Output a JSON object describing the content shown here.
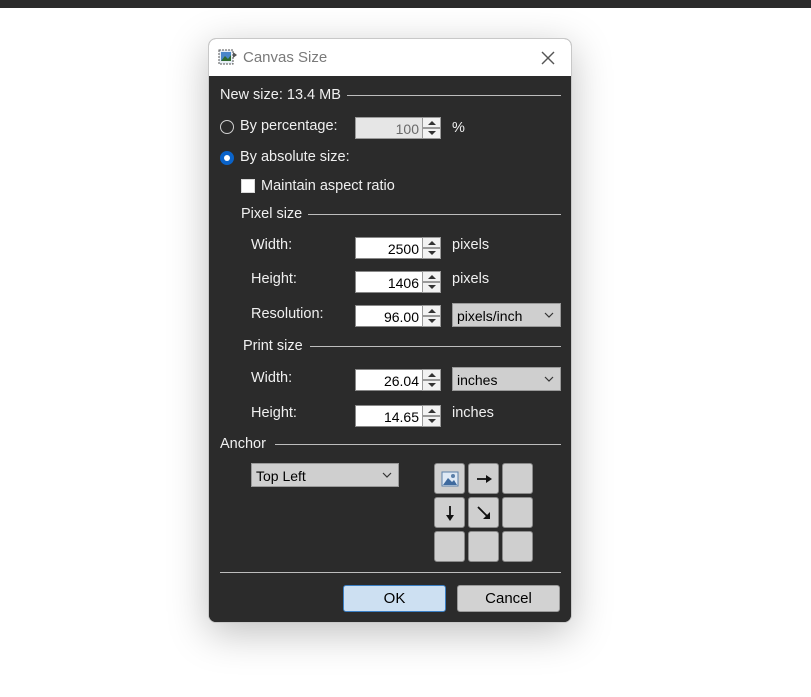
{
  "window": {
    "title": "Canvas Size",
    "icon": "canvas-size-app-icon",
    "close_icon": "close-icon"
  },
  "new_size": {
    "label": "New size: 13.4 MB"
  },
  "mode": {
    "by_percentage": {
      "label": "By percentage:",
      "checked": false,
      "value": "100",
      "unit": "%"
    },
    "by_absolute": {
      "label": "By absolute size:",
      "checked": true
    }
  },
  "maintain_aspect": {
    "label": "Maintain aspect ratio",
    "checked": false
  },
  "pixel_size": {
    "header": "Pixel size",
    "width": {
      "label": "Width:",
      "value": "2500",
      "unit": "pixels"
    },
    "height": {
      "label": "Height:",
      "value": "1406",
      "unit": "pixels"
    },
    "resolution": {
      "label": "Resolution:",
      "value": "96.00",
      "unit": "pixels/inch"
    }
  },
  "print_size": {
    "header": "Print size",
    "width": {
      "label": "Width:",
      "value": "26.04",
      "unit": "inches"
    },
    "height": {
      "label": "Height:",
      "value": "14.65",
      "unit": "inches"
    }
  },
  "anchor": {
    "header": "Anchor",
    "selected": "Top Left",
    "grid": [
      "image-icon",
      "arrow-right-icon",
      "",
      "arrow-down-icon",
      "arrow-down-right-icon",
      "",
      "",
      "",
      ""
    ]
  },
  "buttons": {
    "ok": "OK",
    "cancel": "Cancel"
  },
  "colors": {
    "accent": "#0a63c9",
    "dialog_bg": "#2b2b2b",
    "button_bg": "#d2d2d2"
  }
}
